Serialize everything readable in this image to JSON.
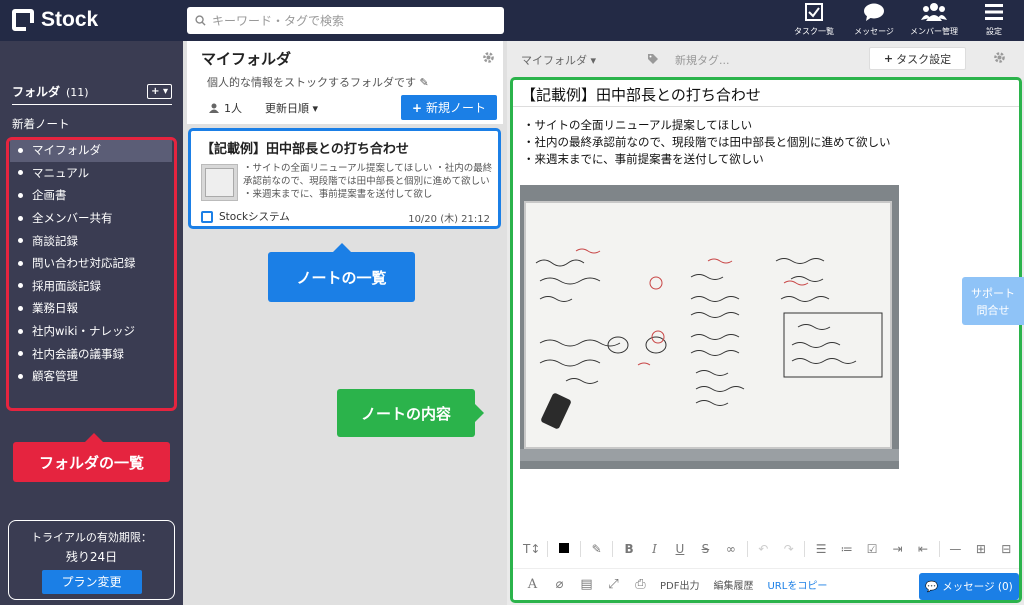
{
  "app": {
    "name": "Stock"
  },
  "search": {
    "placeholder": "キーワード・タグで検索"
  },
  "topnav": [
    {
      "label": "タスク一覧",
      "icon": "task-check-icon"
    },
    {
      "label": "メッセージ",
      "icon": "chat-bubble-icon"
    },
    {
      "label": "メンバー管理",
      "icon": "members-icon"
    },
    {
      "label": "設定",
      "icon": "menu-icon"
    }
  ],
  "sidebar": {
    "folder_label": "フォルダ",
    "folder_count": "(11)",
    "add_label": "+",
    "new_notes": "新着ノート",
    "items": [
      {
        "label": "マイフォルダ",
        "active": true
      },
      {
        "label": "マニュアル"
      },
      {
        "label": "企画書"
      },
      {
        "label": "全メンバー共有"
      },
      {
        "label": "商談記録"
      },
      {
        "label": "問い合わせ対応記録"
      },
      {
        "label": "採用面談記録"
      },
      {
        "label": "業務日報"
      },
      {
        "label": "社内wiki・ナレッジ"
      },
      {
        "label": "社内会議の議事録"
      },
      {
        "label": "顧客管理"
      }
    ],
    "trial_line1": "トライアルの有効期限：",
    "trial_line2": "残り24日",
    "plan_button": "プラン変更"
  },
  "annotations": {
    "folder_list": "フォルダの一覧",
    "note_list": "ノートの一覧",
    "note_content": "ノートの内容"
  },
  "notes_panel": {
    "title": "マイフォルダ",
    "description": "個人的な情報をストックするフォルダです",
    "members": "1人",
    "sort": "更新日順",
    "new_note_button": "新規ノート"
  },
  "note_card": {
    "title": "【記載例】田中部長との打ち合わせ",
    "snippet": "・サイトの全面リニューアル提案してほしい ・社内の最終承認前なので、現段階では田中部長と個別に進めて欲しい ・来週末までに、事前提案書を送付して欲し",
    "owner": "Stockシステム",
    "date": "10/20 (木) 21:12"
  },
  "content_bar": {
    "breadcrumb": "マイフォルダ",
    "tag_placeholder": "新規タグ...",
    "task_button": "タスク設定"
  },
  "editor": {
    "title": "【記載例】田中部長との打ち合わせ",
    "lines": [
      "・サイトの全面リニューアル提案してほしい",
      "・社内の最終承認前なので、現段階では田中部長と個別に進めて欲しい",
      "・来週末までに、事前提案書を送付して欲しい"
    ]
  },
  "bottom_bar": {
    "pdf": "PDF出力",
    "history": "編集履歴",
    "copy_url": "URLをコピー",
    "message_button": "メッセージ (0)"
  },
  "support": {
    "line1": "サポート",
    "line2": "問合せ"
  },
  "colors": {
    "topbar": "#232a45",
    "sidebar": "#3a3c52",
    "accent_blue": "#1b7fe6",
    "annotation_red": "#e5243f",
    "annotation_green": "#2bb34b"
  }
}
